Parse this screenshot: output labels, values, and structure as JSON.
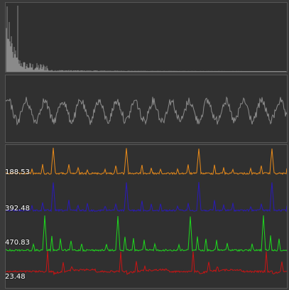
{
  "colors": {
    "background": "#3a3a3a",
    "panel": "#303030",
    "spectrum": "#8a8a8a",
    "waveform": "#8c8c8c",
    "channel_orange": "#e88a1a",
    "channel_blue": "#2a1ab8",
    "channel_green": "#1ed81e",
    "channel_red": "#c81414"
  },
  "channels": [
    {
      "label": "188.53",
      "color": "#e88a1a"
    },
    {
      "label": "392.48",
      "color": "#2a1ab8"
    },
    {
      "label": "470.83",
      "color": "#1ed81e"
    },
    {
      "label": "23.48",
      "color": "#c81414"
    }
  ]
}
